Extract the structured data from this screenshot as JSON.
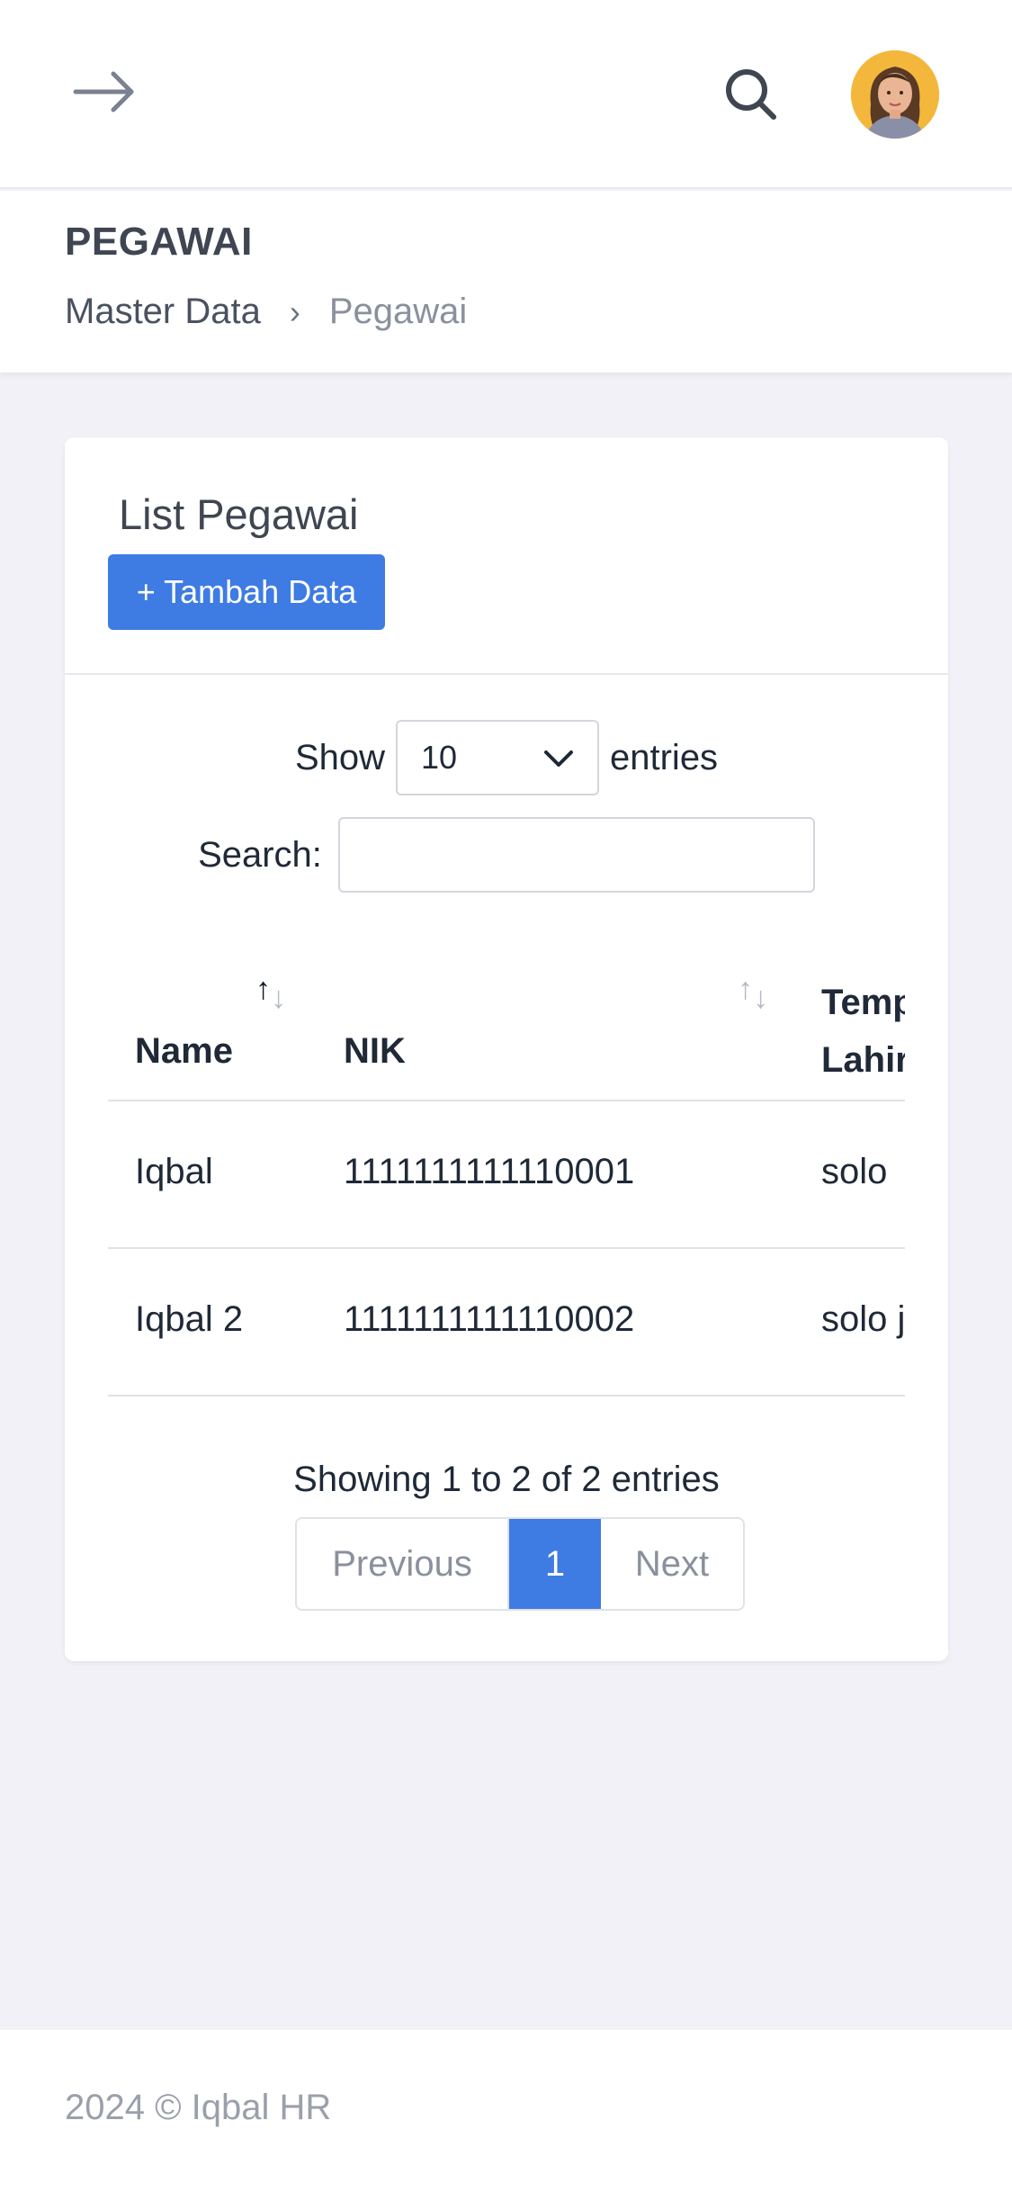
{
  "header": {
    "menu_icon": "arrow-right-icon",
    "search_icon": "search-icon",
    "avatar_icon": "user-avatar"
  },
  "page": {
    "title": "PEGAWAI",
    "breadcrumb": [
      "Master Data",
      "Pegawai"
    ],
    "breadcrumb_separator": "›"
  },
  "card": {
    "title": "List Pegawai",
    "add_button": "+ Tambah Data",
    "length": {
      "prefix": "Show",
      "value": "10",
      "suffix": "entries"
    },
    "search": {
      "label": "Search:",
      "value": "",
      "placeholder": ""
    },
    "table": {
      "columns": [
        {
          "label": "Name",
          "sort": "asc"
        },
        {
          "label": "NIK",
          "sort": "none"
        },
        {
          "label": "Tempat Lahir",
          "sort": "none"
        }
      ],
      "rows": [
        {
          "name": "Iqbal",
          "nik": "1111111111110001",
          "tempat": "solo"
        },
        {
          "name": "Iqbal 2",
          "nik": "1111111111110002",
          "tempat": "solo juga"
        }
      ]
    },
    "info": "Showing 1 to 2 of 2 entries",
    "pagination": {
      "previous": "Previous",
      "current": "1",
      "next": "Next"
    }
  },
  "footer": {
    "text": "2024 © Iqbal HR"
  },
  "colors": {
    "primary": "#3e7be3",
    "background": "#f1f1f7",
    "muted_text": "#8a909c"
  }
}
